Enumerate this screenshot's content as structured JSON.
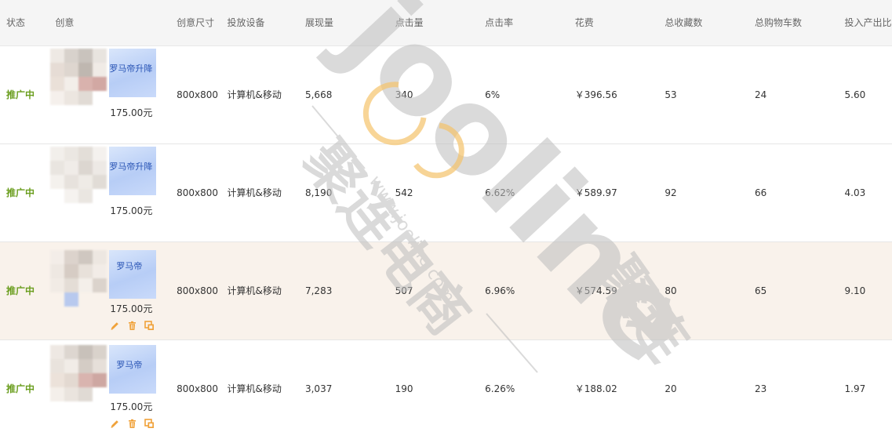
{
  "columns": {
    "status": "状态",
    "creative": "创意",
    "size": "创意尺寸",
    "device": "投放设备",
    "impressions": "展现量",
    "clicks": "点击量",
    "ctr": "点击率",
    "cost": "花费",
    "favorites": "总收藏数",
    "cart": "总购物车数",
    "roi": "投入产出比"
  },
  "rows": [
    {
      "status": "推广中",
      "creative_text": "罗马帝升降",
      "price": "175.00元",
      "size": "800x800",
      "device": "计算机&移动",
      "impressions": "5,668",
      "clicks": "340",
      "ctr": "6%",
      "cost": "￥396.56",
      "favorites": "53",
      "cart": "24",
      "roi": "5.60"
    },
    {
      "status": "推广中",
      "creative_text": "罗马帝升降",
      "price": "175.00元",
      "size": "800x800",
      "device": "计算机&移动",
      "impressions": "8,190",
      "clicks": "542",
      "ctr": "6.62%",
      "cost": "￥589.97",
      "favorites": "92",
      "cart": "66",
      "roi": "4.03"
    },
    {
      "status": "推广中",
      "creative_text": "罗马帝",
      "price": "175.00元",
      "size": "800x800",
      "device": "计算机&移动",
      "impressions": "7,283",
      "clicks": "507",
      "ctr": "6.96%",
      "cost": "￥574.59",
      "favorites": "80",
      "cart": "65",
      "roi": "9.10"
    },
    {
      "status": "推广中",
      "creative_text": "罗马帝",
      "price": "175.00元",
      "size": "800x800",
      "device": "计算机&移动",
      "impressions": "3,037",
      "clicks": "190",
      "ctr": "6.26%",
      "cost": "￥188.02",
      "favorites": "20",
      "cart": "23",
      "roi": "1.97"
    }
  ],
  "row_actions": [
    "edit-icon",
    "delete-icon",
    "copy-icon"
  ],
  "watermark": {
    "brand": "jooline",
    "url": "www.jooline.com",
    "cn_main": "聚连电商",
    "cn_side": "聚连"
  },
  "colors": {
    "status_green": "#6b9e1f",
    "highlight_row": "#f9f2eb",
    "header_bg": "#f5f5f5",
    "action_orange": "#f0a23a",
    "watermark_gray": "#bdbdbd",
    "watermark_gold": "#f5c36b"
  }
}
